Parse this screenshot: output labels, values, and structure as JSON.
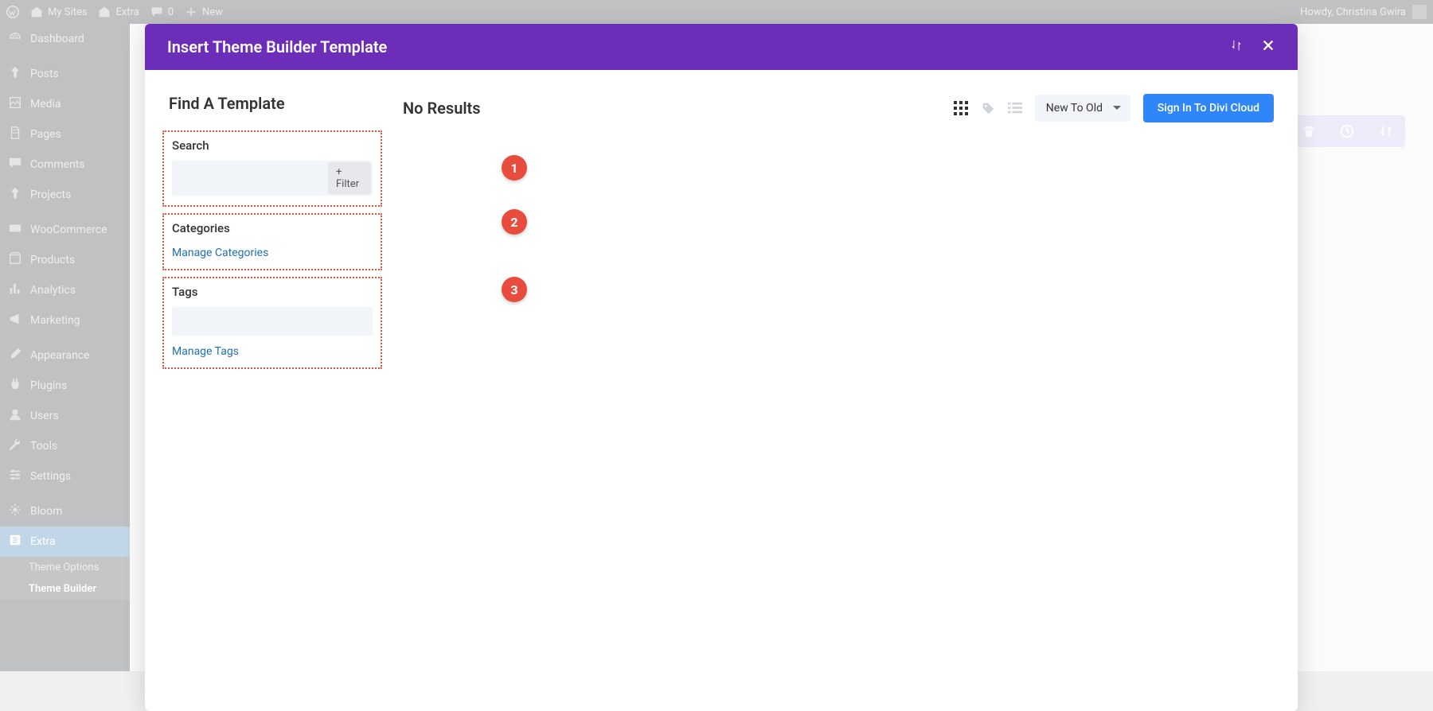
{
  "adminbar": {
    "my_sites": "My Sites",
    "site_name": "Extra",
    "comments": "0",
    "new": "New",
    "howdy": "Howdy, Christina Gwira"
  },
  "sidebar": {
    "items": [
      {
        "label": "Dashboard",
        "icon": "dashboard"
      },
      {
        "label": "Posts",
        "icon": "pin"
      },
      {
        "label": "Media",
        "icon": "media"
      },
      {
        "label": "Pages",
        "icon": "pages"
      },
      {
        "label": "Comments",
        "icon": "comment"
      },
      {
        "label": "Projects",
        "icon": "pin"
      },
      {
        "label": "WooCommerce",
        "icon": "woo"
      },
      {
        "label": "Products",
        "icon": "products"
      },
      {
        "label": "Analytics",
        "icon": "analytics"
      },
      {
        "label": "Marketing",
        "icon": "marketing"
      },
      {
        "label": "Appearance",
        "icon": "brush"
      },
      {
        "label": "Plugins",
        "icon": "plugin"
      },
      {
        "label": "Users",
        "icon": "user"
      },
      {
        "label": "Tools",
        "icon": "tools"
      },
      {
        "label": "Settings",
        "icon": "settings"
      },
      {
        "label": "Bloom",
        "icon": "bloom"
      },
      {
        "label": "Extra",
        "icon": "extra",
        "current": true
      }
    ],
    "submenu": [
      {
        "label": "Theme Options"
      },
      {
        "label": "Theme Builder",
        "current": true
      }
    ]
  },
  "modal": {
    "title": "Insert Theme Builder Template",
    "find_template": "Find A Template",
    "search_label": "Search",
    "filter_btn": "+ Filter",
    "categories_label": "Categories",
    "manage_categories": "Manage Categories",
    "tags_label": "Tags",
    "manage_tags": "Manage Tags",
    "no_results": "No Results",
    "sort_options": [
      "New To Old"
    ],
    "sort_selected": "New To Old",
    "signin": "Sign In To Divi Cloud"
  },
  "callouts": [
    "1",
    "2",
    "3"
  ]
}
